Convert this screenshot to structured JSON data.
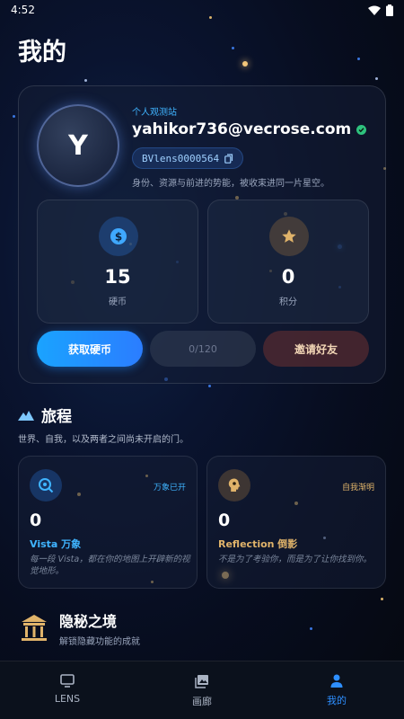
{
  "status_bar": {
    "time": "4:52"
  },
  "page_title": "我的",
  "profile": {
    "avatar_letter": "Y",
    "tag": "个人观测站",
    "email": "yahikor736@vecrose.com",
    "uid": "BVlens0000564",
    "description": "身份、资源与前进的势能，被收束进同一片星空。"
  },
  "stats": [
    {
      "icon": "coin-icon",
      "value": "15",
      "label": "硬币"
    },
    {
      "icon": "star-icon",
      "value": "0",
      "label": "积分"
    }
  ],
  "buttons": {
    "get_coins": "获取硬币",
    "progress": "0/120",
    "invite": "邀请好友"
  },
  "journey": {
    "title": "旅程",
    "subtitle": "世界、自我，以及两者之间尚未开启的门。",
    "cards": [
      {
        "icon": "vista-icon",
        "badge": "万象已开",
        "value": "0",
        "title": "Vista 万象",
        "desc": "每一段 Vista，都在你的地图上开辟新的视觉地形。",
        "accent": "#3fb4ff"
      },
      {
        "icon": "reflection-icon",
        "badge": "自我渐明",
        "value": "0",
        "title": "Reflection 倒影",
        "desc": "不是为了考验你，而是为了让你找到你。",
        "accent": "#e0b36a"
      }
    ]
  },
  "secret": {
    "title": "隐秘之境",
    "subtitle": "解锁隐藏功能的成就"
  },
  "nav": [
    {
      "icon": "tv-icon",
      "label": "LENS",
      "active": false
    },
    {
      "icon": "gallery-icon",
      "label": "画廊",
      "active": false
    },
    {
      "icon": "person-icon",
      "label": "我的",
      "active": true
    }
  ],
  "colors": {
    "accent": "#2e8fff",
    "link": "#3fb4ff",
    "gold": "#e0b36a",
    "invite_bg": "#6e3232",
    "background": "#070d1f"
  }
}
